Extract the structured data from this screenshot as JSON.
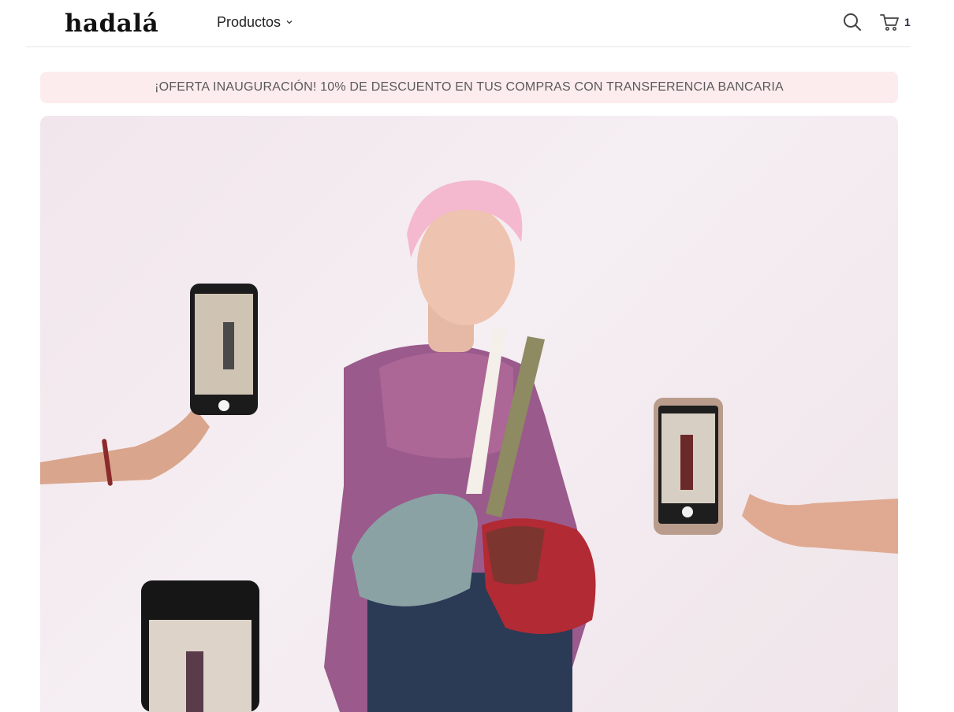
{
  "header": {
    "logo": "hadalá",
    "nav_products_label": "Productos",
    "cart_count": "1"
  },
  "promo": {
    "text": "¡OFERTA INAUGURACIÓN! 10% DE DESCUENTO EN TUS COMPRAS CON TRANSFERENCIA BANCARIA"
  },
  "hero": {
    "icon": "model-with-bags-photo"
  },
  "colors": {
    "promo_bg": "#fdeced",
    "hero_bg": "#f3eaef",
    "text": "#1a1a1a"
  }
}
